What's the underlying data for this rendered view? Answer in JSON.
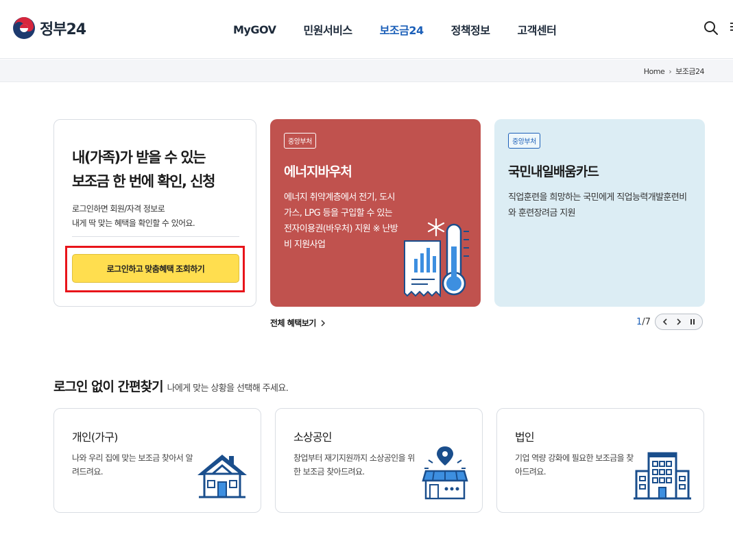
{
  "header": {
    "logo_text": "정부24",
    "nav": [
      {
        "label": "MyGOV"
      },
      {
        "label": "민원서비스"
      },
      {
        "label": "보조금24"
      },
      {
        "label": "정책정보"
      },
      {
        "label": "고객센터"
      }
    ],
    "active_nav": "보조금24",
    "icons": {
      "search": "search-icon",
      "menu": "menu-icon"
    }
  },
  "breadcrumb": {
    "items": [
      "Home",
      "보조금24"
    ]
  },
  "hero": {
    "login_card": {
      "title_line1": "내(가족)가 받을 수 있는",
      "title_line2": "보조금 한 번에 확인, 신청",
      "desc_line1": "로그인하면 회원/자격 정보로",
      "desc_line2": "내게 딱 맞는 혜택을 확인할 수 있어요.",
      "button_label": "로그인하고 맞춤혜택 조회하기"
    },
    "cards": [
      {
        "badge": "중앙부처",
        "title": "에너지바우처",
        "desc": "에너지 취약계층에서 전기, 도시가스, LPG 등을 구입할 수 있는 전자이용권(바우처) 지원 ※ 난방비 지원사업",
        "color": "#c0524e",
        "icon": "thermometer-chart-icon"
      },
      {
        "badge": "중앙부처",
        "title": "국민내일배움카드",
        "desc": "직업훈련을 희망하는 국민에게 직업능력개발훈련비와 훈련장려금 지원",
        "color": "#dcedf4"
      }
    ],
    "more_link": "전체 혜택보기",
    "pager": {
      "current": "1",
      "separator": "/",
      "total": "7"
    }
  },
  "quick_find": {
    "title": "로그인 없이 간편찾기",
    "subtitle": "나에게 맞는 상황을 선택해 주세요.",
    "cards": [
      {
        "title": "개인(가구)",
        "desc": "나와 우리 집에 맞는 보조금 찾아서 알려드려요.",
        "icon": "house-icon"
      },
      {
        "title": "소상공인",
        "desc": "창업부터 재기지원까지 소상공인을 위한 보조금 찾아드려요.",
        "icon": "store-icon"
      },
      {
        "title": "법인",
        "desc": "기업 역량 강화에 필요한 보조금을 찾아드려요.",
        "icon": "building-icon"
      }
    ]
  },
  "colors": {
    "primary_blue": "#1b5fb8",
    "highlight_red": "#e8141a",
    "login_yellow": "#ffde4f",
    "icon_navy": "#1a4e8c"
  }
}
